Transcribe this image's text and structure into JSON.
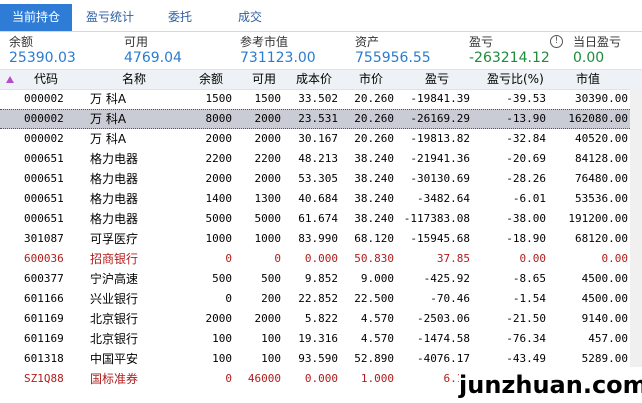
{
  "tabs": [
    "当前持仓",
    "盈亏统计",
    "委托",
    "成交"
  ],
  "summary": [
    {
      "label": "余额",
      "value": "25390.03"
    },
    {
      "label": "可用",
      "value": "4769.04"
    },
    {
      "label": "参考市值",
      "value": "731123.00"
    },
    {
      "label": "资产",
      "value": "755956.55"
    },
    {
      "label": "盈亏",
      "value": "-263214.12"
    },
    {
      "label": "当日盈亏",
      "value": "0.00"
    }
  ],
  "columns": [
    "代码",
    "名称",
    "余额",
    "可用",
    "成本价",
    "市价",
    "盈亏",
    "盈亏比(%)",
    "市值"
  ],
  "rows": [
    [
      "000002",
      "万 科A",
      "1500",
      "1500",
      "33.502",
      "20.260",
      "-19841.39",
      "-39.53",
      "30390.00"
    ],
    [
      "000002",
      "万  科A",
      "8000",
      "2000",
      "23.531",
      "20.260",
      "-26169.29",
      "-13.90",
      "162080.00"
    ],
    [
      "000002",
      "万 科A",
      "2000",
      "2000",
      "30.167",
      "20.260",
      "-19813.82",
      "-32.84",
      "40520.00"
    ],
    [
      "000651",
      "格力电器",
      "2200",
      "2200",
      "48.213",
      "38.240",
      "-21941.36",
      "-20.69",
      "84128.00"
    ],
    [
      "000651",
      "格力电器",
      "2000",
      "2000",
      "53.305",
      "38.240",
      "-30130.69",
      "-28.26",
      "76480.00"
    ],
    [
      "000651",
      "格力电器",
      "1400",
      "1300",
      "40.684",
      "38.240",
      "-3482.64",
      "-6.01",
      "53536.00"
    ],
    [
      "000651",
      "格力电器",
      "5000",
      "5000",
      "61.674",
      "38.240",
      "-117383.08",
      "-38.00",
      "191200.00"
    ],
    [
      "301087",
      "可孚医疗",
      "1000",
      "1000",
      "83.990",
      "68.120",
      "-15945.68",
      "-18.90",
      "68120.00"
    ],
    [
      "600036",
      "招商银行",
      "0",
      "0",
      "0.000",
      "50.830",
      "37.85",
      "0.00",
      "0.00"
    ],
    [
      "600377",
      "宁沪高速",
      "500",
      "500",
      "9.852",
      "9.000",
      "-425.92",
      "-8.65",
      "4500.00"
    ],
    [
      "601166",
      "兴业银行",
      "0",
      "200",
      "22.852",
      "22.500",
      "-70.46",
      "-1.54",
      "4500.00"
    ],
    [
      "601169",
      "北京银行",
      "2000",
      "2000",
      "5.822",
      "4.570",
      "-2503.06",
      "-21.50",
      "9140.00"
    ],
    [
      "601169",
      "北京银行",
      "100",
      "100",
      "19.316",
      "4.570",
      "-1474.58",
      "-76.34",
      "457.00"
    ],
    [
      "601318",
      "中国平安",
      "100",
      "100",
      "93.590",
      "52.890",
      "-4076.17",
      "-43.49",
      "5289.00"
    ],
    [
      "SZ1Q88",
      "国标准券",
      "0",
      "46000",
      "0.000",
      "1.000",
      "6.17",
      "0.00",
      "46000.00"
    ]
  ],
  "watermark": "junzhuan.com"
}
